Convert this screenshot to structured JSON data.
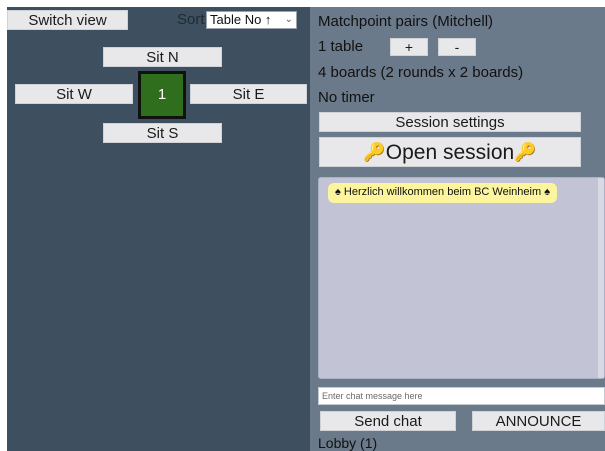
{
  "left": {
    "switch_view_label": "Switch view",
    "sort_label": "Sort:",
    "sort_value": "Table No ↑",
    "seats": {
      "north": "Sit N",
      "west": "Sit W",
      "east": "Sit E",
      "south": "Sit S"
    },
    "table_number": "1"
  },
  "right": {
    "mode": "Matchpoint pairs (Mitchell)",
    "tables": "1 table",
    "plus_label": "+",
    "minus_label": "-",
    "boards": "4 boards (2 rounds x 2 boards)",
    "timer": "No timer",
    "session_settings_label": "Session settings",
    "open_session_label": "Open session",
    "chat_messages": [
      {
        "text": "♠ Herzlich willkommen beim BC Weinheim ♠"
      }
    ],
    "chat_input_placeholder": "Enter chat message here",
    "send_chat_label": "Send chat",
    "announce_label": "ANNOUNCE",
    "lobby_label": "Lobby (1)"
  },
  "colors": {
    "left_panel_bg": "#3e5060",
    "right_panel_bg": "#6b7a8a",
    "table_green": "#2f6e1c",
    "chat_bg": "#c2c4d6",
    "message_bg": "#fdf59d",
    "key_gold": "#d59414"
  },
  "icons": {
    "key": "key-icon",
    "sort_dropdown": "chevron-down-icon"
  }
}
